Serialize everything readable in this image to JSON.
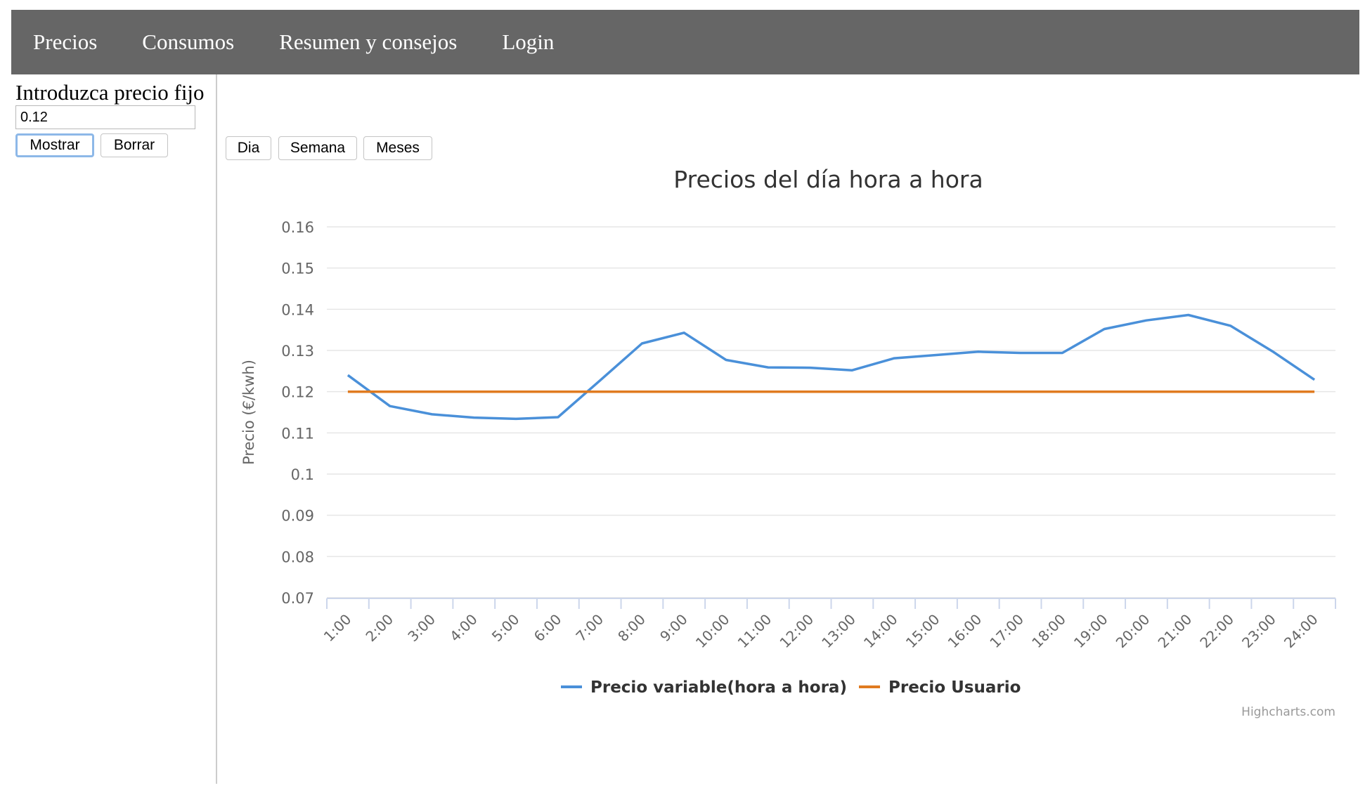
{
  "nav": {
    "items": [
      {
        "label": "Precios"
      },
      {
        "label": "Consumos"
      },
      {
        "label": "Resumen y consejos"
      },
      {
        "label": "Login"
      }
    ]
  },
  "sidebar": {
    "label": "Introduzca precio fijo",
    "input_value": "0.12",
    "show_button": "Mostrar",
    "clear_button": "Borrar"
  },
  "period_buttons": {
    "day": "Dia",
    "week": "Semana",
    "months": "Meses"
  },
  "chart_data": {
    "type": "line",
    "title": "Precios del día hora a hora",
    "xlabel": "",
    "ylabel": "Precio (€/kwh)",
    "categories": [
      "1:00",
      "2:00",
      "3:00",
      "4:00",
      "5:00",
      "6:00",
      "7:00",
      "8:00",
      "9:00",
      "10:00",
      "11:00",
      "12:00",
      "13:00",
      "14:00",
      "15:00",
      "16:00",
      "17:00",
      "18:00",
      "19:00",
      "20:00",
      "21:00",
      "22:00",
      "23:00",
      "24:00"
    ],
    "ylim": [
      0.07,
      0.16
    ],
    "yticks": [
      "0.07",
      "0.08",
      "0.09",
      "0.1",
      "0.11",
      "0.12",
      "0.13",
      "0.14",
      "0.15",
      "0.16"
    ],
    "grid": true,
    "legend_position": "bottom",
    "series": [
      {
        "name": "Precio variable(hora a hora)",
        "color": "#4a90d9",
        "values": [
          0.124,
          0.1165,
          0.1145,
          0.1137,
          0.1134,
          0.1138,
          0.1227,
          0.1317,
          0.1343,
          0.1277,
          0.1259,
          0.1258,
          0.1252,
          0.1281,
          0.1289,
          0.1297,
          0.1294,
          0.1294,
          0.1352,
          0.1373,
          0.1386,
          0.136,
          0.1298,
          0.1229
        ]
      },
      {
        "name": "Precio Usuario",
        "color": "#e07b20",
        "values": [
          0.12,
          0.12,
          0.12,
          0.12,
          0.12,
          0.12,
          0.12,
          0.12,
          0.12,
          0.12,
          0.12,
          0.12,
          0.12,
          0.12,
          0.12,
          0.12,
          0.12,
          0.12,
          0.12,
          0.12,
          0.12,
          0.12,
          0.12,
          0.12
        ]
      }
    ],
    "credits": "Highcharts.com"
  }
}
